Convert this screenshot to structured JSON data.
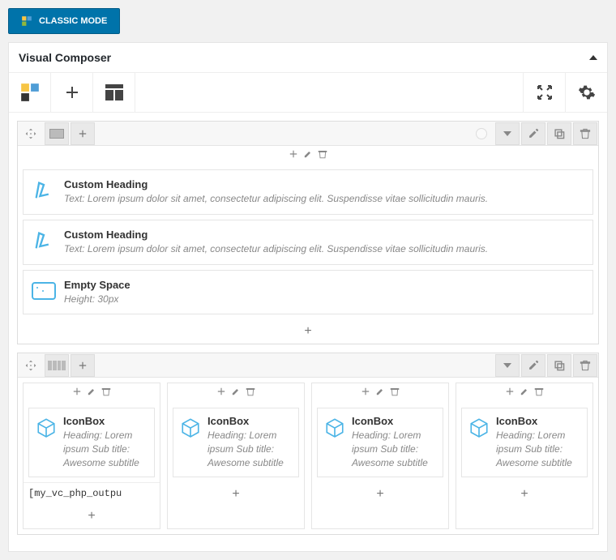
{
  "classic_mode": "CLASSIC MODE",
  "panel_title": "Visual Composer",
  "row1": {
    "items": [
      {
        "title": "Custom Heading",
        "sub": "Text: Lorem ipsum dolor sit amet, consectetur adipiscing elit. Suspendisse vitae sollicitudin mauris."
      },
      {
        "title": "Custom Heading",
        "sub": "Text: Lorem ipsum dolor sit amet, consectetur adipiscing elit. Suspendisse vitae sollicitudin mauris."
      },
      {
        "title": "Empty Space",
        "sub": "Height: 30px"
      }
    ]
  },
  "row2": {
    "cols": [
      {
        "title": "IconBox",
        "sub": "Heading: Lorem ipsum Sub title: Awesome subtitle",
        "shortcode": "[my_vc_php_outpu"
      },
      {
        "title": "IconBox",
        "sub": "Heading: Lorem ipsum Sub title: Awesome subtitle"
      },
      {
        "title": "IconBox",
        "sub": "Heading: Lorem ipsum Sub title: Awesome subtitle"
      },
      {
        "title": "IconBox",
        "sub": "Heading: Lorem ipsum Sub title: Awesome subtitle"
      }
    ]
  }
}
